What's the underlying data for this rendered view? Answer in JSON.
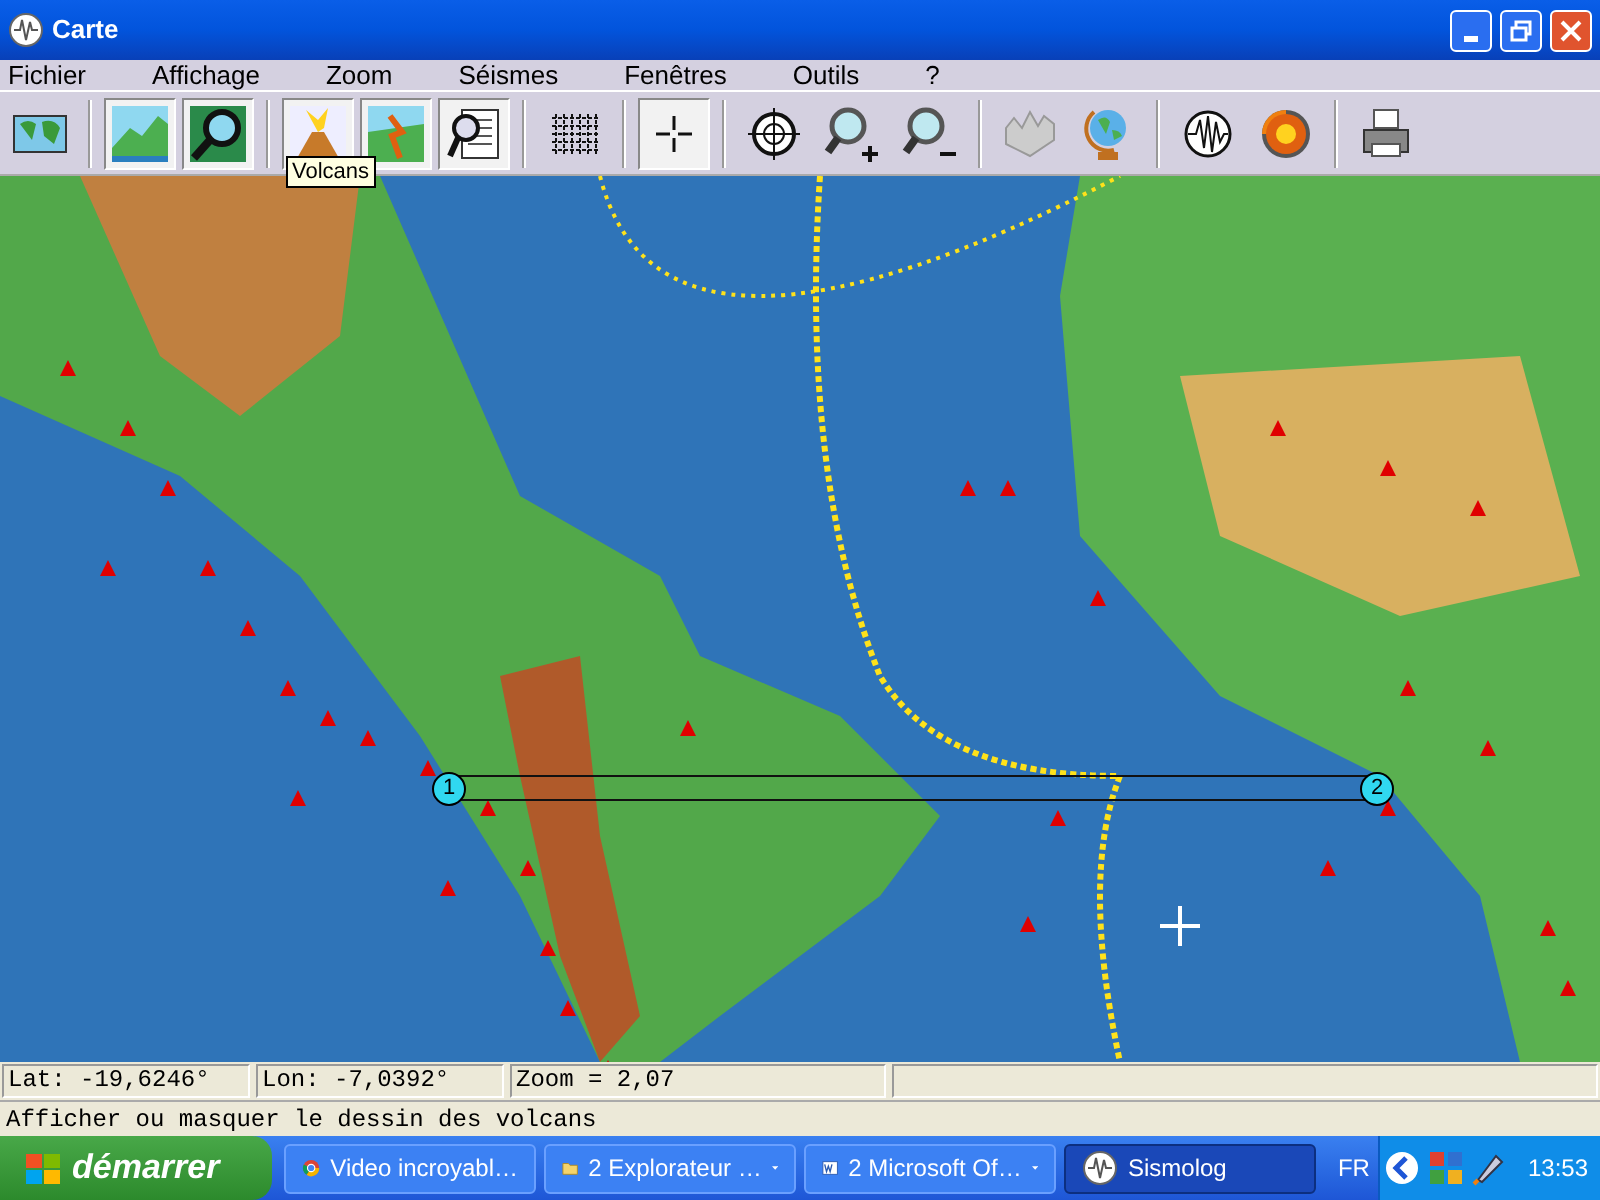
{
  "window": {
    "title": "Carte"
  },
  "menu": [
    "Fichier",
    "Affichage",
    "Zoom",
    "Séismes",
    "Fenêtres",
    "Outils",
    "?"
  ],
  "toolbar": [
    {
      "kind": "map",
      "selected": false
    },
    {
      "kind": "relief",
      "selected": true
    },
    {
      "kind": "zoom-area",
      "selected": true
    },
    {
      "kind": "volcano",
      "selected": true
    },
    {
      "kind": "fault",
      "selected": true
    },
    {
      "kind": "document",
      "selected": true
    },
    {
      "kind": "grid",
      "selected": false
    },
    {
      "kind": "crosshair",
      "selected": true
    },
    {
      "kind": "target",
      "selected": false
    },
    {
      "kind": "zoom-in",
      "selected": false
    },
    {
      "kind": "zoom-out",
      "selected": false
    },
    {
      "kind": "terrain",
      "selected": false
    },
    {
      "kind": "globe",
      "selected": false
    },
    {
      "kind": "seismogram",
      "selected": false
    },
    {
      "kind": "earth",
      "selected": false
    },
    {
      "kind": "printer",
      "selected": false
    }
  ],
  "tooltip": "Volcans",
  "map": {
    "profile_points": [
      "1",
      "2"
    ]
  },
  "status_bar": [
    "Lat: -19,6246°",
    "Lon: -7,0392°",
    "Zoom = 2,07"
  ],
  "hint": "Afficher ou masquer le dessin des volcans",
  "taskbar": {
    "start": "démarrer",
    "tasks": [
      {
        "kind": "browser",
        "label": "Video incroyabl…",
        "grouped": false,
        "selected": false
      },
      {
        "kind": "folder",
        "label": "2 Explorateur …",
        "grouped": true,
        "selected": false
      },
      {
        "kind": "word",
        "label": "2 Microsoft Of…",
        "grouped": true,
        "selected": false
      },
      {
        "kind": "app",
        "label": "Sismolog",
        "grouped": false,
        "selected": true
      }
    ],
    "language": "FR",
    "clock": "13:53"
  }
}
